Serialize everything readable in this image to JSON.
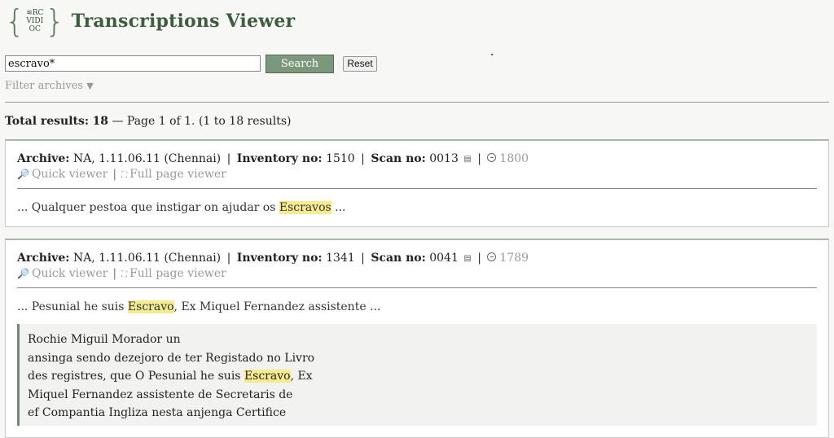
{
  "app": {
    "title": "Transcriptions Viewer",
    "logo": {
      "left_brace": "{",
      "right_brace": "}",
      "line1": "≋RC",
      "line2": "VIDI",
      "line3": "OC"
    }
  },
  "search": {
    "value": "escravo*",
    "placeholder": "",
    "search_label": "Search",
    "reset_label": "Reset"
  },
  "filter": {
    "label": "Filter archives",
    "arrow": "▼"
  },
  "totals": {
    "label": "Total results:",
    "count": "18",
    "rest": " — Page 1 of 1. (1 to 18 results)"
  },
  "labels": {
    "archive": "Archive:",
    "inventory": "Inventory no:",
    "scan": "Scan no:",
    "quick_viewer": "Quick viewer",
    "full_viewer": "Full page viewer",
    "pipe": "|"
  },
  "results": [
    {
      "archive": "NA, 1.11.06.11 (Chennai)",
      "inventory": "1510",
      "scan": "0013",
      "year": "1800",
      "snippet_before": "... Qualquer pestoa que instigar on ajudar os ",
      "snippet_hl": "Escravos",
      "snippet_after": " ..."
    },
    {
      "archive": "NA, 1.11.06.11 (Chennai)",
      "inventory": "1341",
      "scan": "0041",
      "year": "1789",
      "snippet_before": "... Pesunial he suis ",
      "snippet_hl": "Escravo",
      "snippet_after": ", Ex Miquel Fernandez assistente ...",
      "transcript": {
        "line1": "Rochie Miguil Morador un",
        "line2": "ansinga sendo dezejoro de ter Registado no Livro",
        "line3_before": "des registres, que O Pesunial he suis ",
        "line3_hl": "Escravo",
        "line3_after": ", Ex",
        "line4": "Miquel Fernandez assistente de Secretaris de",
        "line5": "ef Compantia Ingliza nesta anjenga Certifice"
      }
    }
  ],
  "icons": {
    "magnifier": "🔎",
    "fullpage": "⛶",
    "scan": "▤"
  },
  "colors": {
    "accent": "#3d5e3d",
    "button": "#7d977d",
    "highlight": "#f6ec8f"
  }
}
